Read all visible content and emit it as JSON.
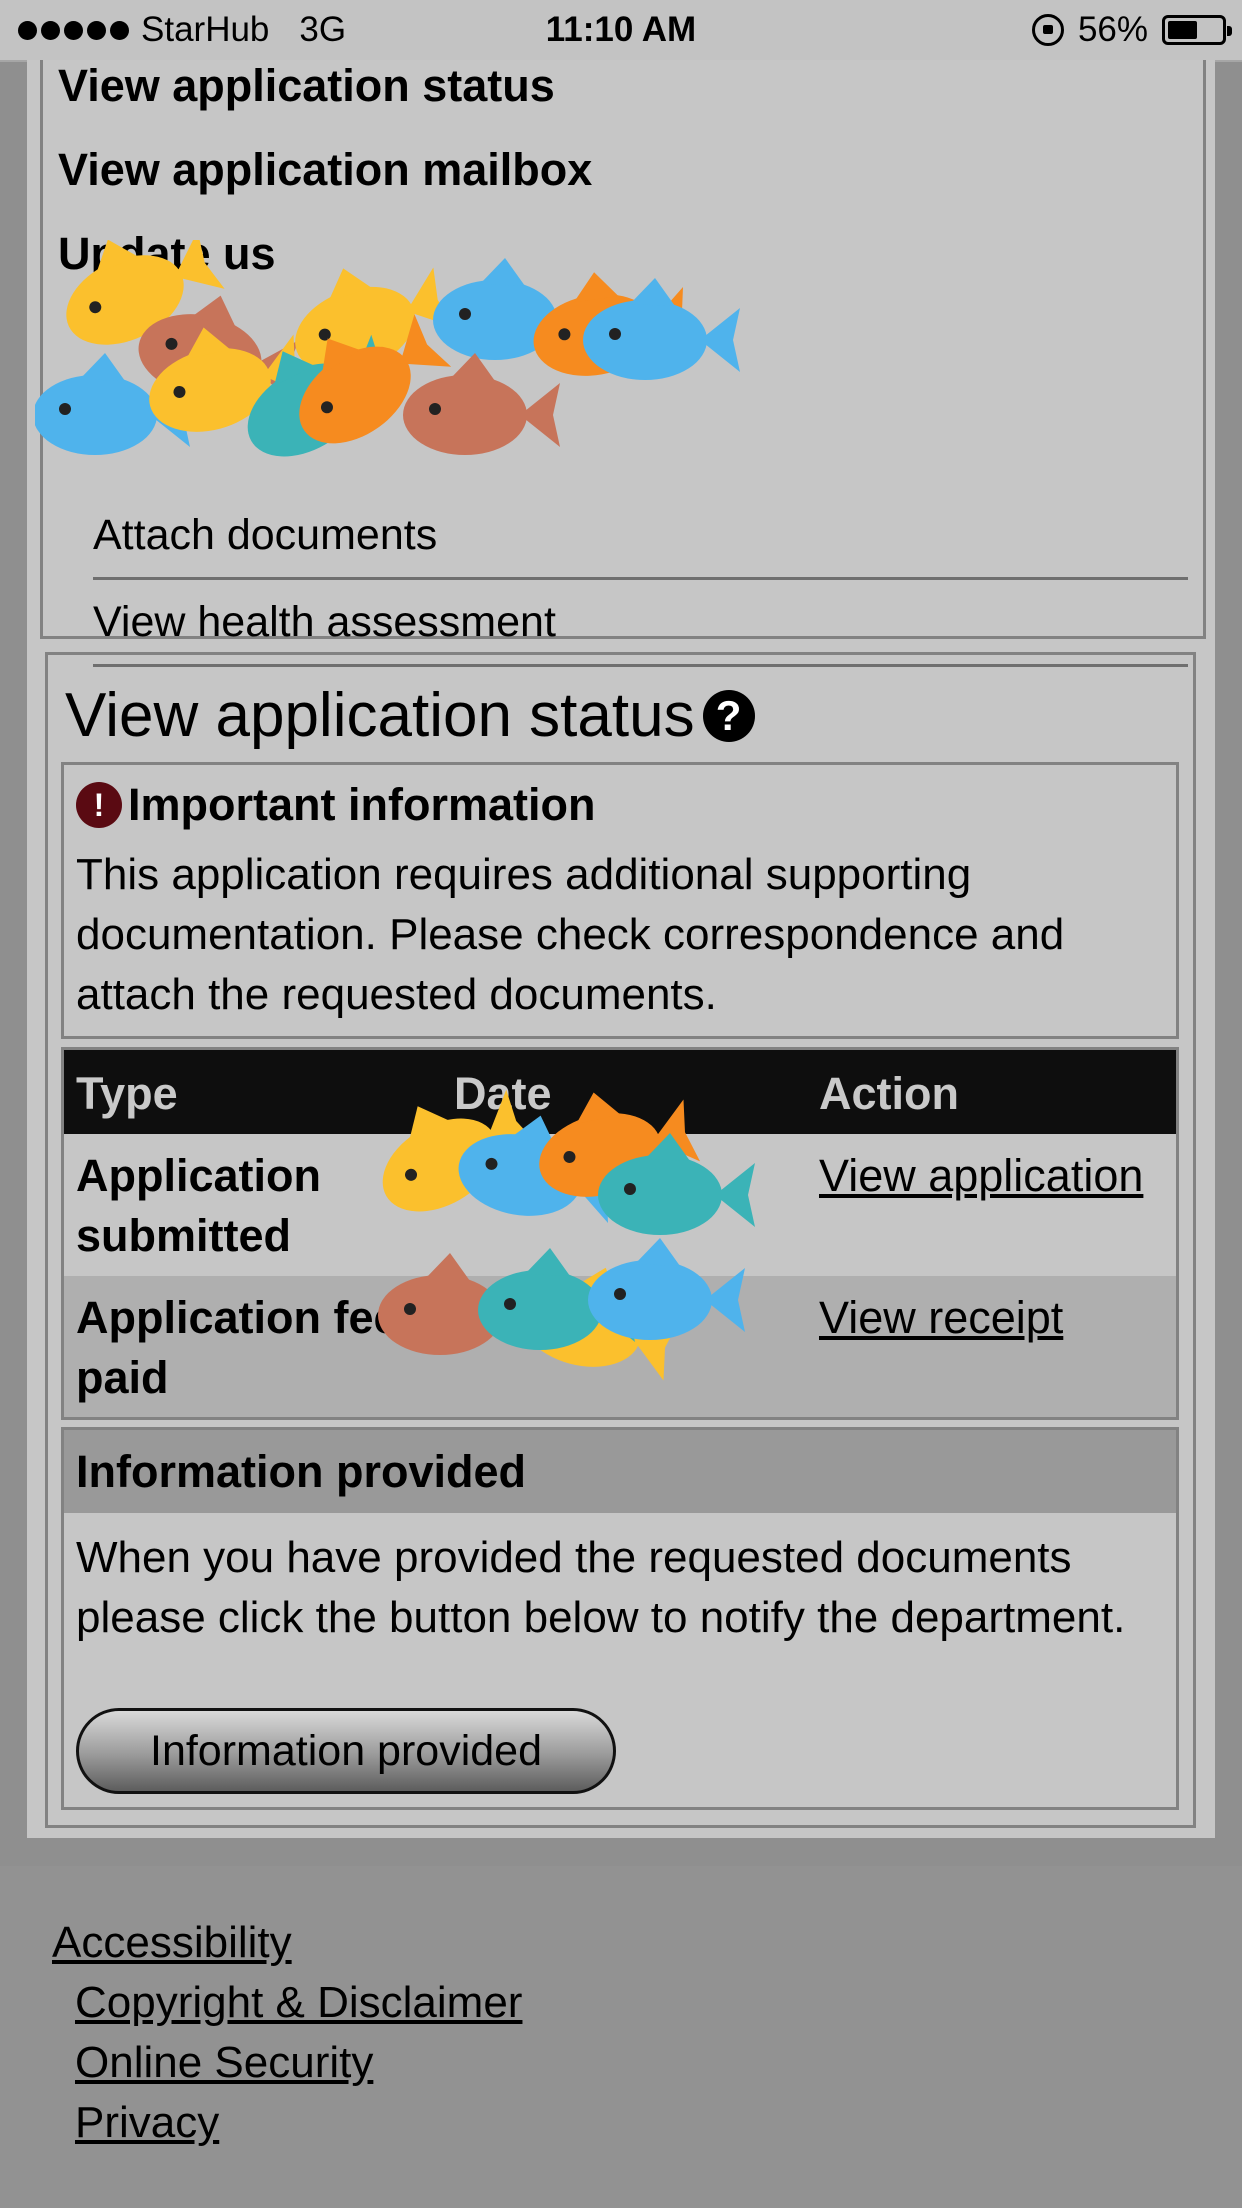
{
  "status_bar": {
    "carrier": "StarHub",
    "network": "3G",
    "time": "11:10 AM",
    "battery": "56%",
    "battery_level": 0.56
  },
  "nav": {
    "links": [
      "View application status",
      "View application mailbox",
      "Update us"
    ],
    "sub_links": [
      "Attach documents",
      "View health assessment"
    ]
  },
  "status_section": {
    "title": "View application status",
    "important": {
      "heading": "Important information",
      "text": "This application requires additional supporting documentation. Please check correspondence and attach the requested documents."
    },
    "table": {
      "headers": [
        "Type",
        "Date",
        "Action"
      ],
      "rows": [
        {
          "type": "Application submitted",
          "date": "",
          "action": "View application"
        },
        {
          "type": "Application fee paid",
          "date": "",
          "action": "View receipt"
        }
      ]
    }
  },
  "information_provided": {
    "heading": "Information provided",
    "text": "When you have provided the requested documents please click the button below to notify the department.",
    "button_label": "Information provided"
  },
  "footer": {
    "links": [
      "Accessibility",
      "Copyright & Disclaimer",
      "Online Security",
      "Privacy"
    ]
  },
  "colors": {
    "fish_yellow": "#fbc02d",
    "fish_orange": "#f68b1f",
    "fish_blue": "#4fb3ec",
    "fish_teal": "#3bb3b7",
    "fish_brown": "#c7745a"
  }
}
